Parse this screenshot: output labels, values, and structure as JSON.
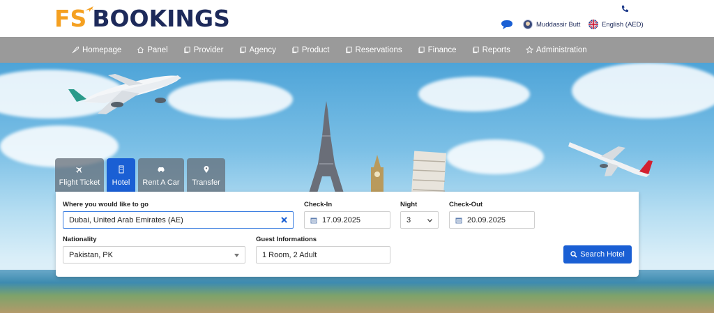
{
  "brand": {
    "prefix": "FS",
    "name": "BOOKINGS",
    "prefix_color": "#f5a020",
    "name_color": "#1d2a5a"
  },
  "header": {
    "user_name": "Muddassir Butt",
    "language": "English (AED)",
    "icons": [
      "phone-icon",
      "chat-icon",
      "avatar",
      "uk-flag-icon"
    ]
  },
  "nav": {
    "background": "#9a9a9a",
    "items": [
      {
        "label": "Homepage",
        "icon": "rocket-icon"
      },
      {
        "label": "Panel",
        "icon": "home-icon"
      },
      {
        "label": "Provider",
        "icon": "copy-icon"
      },
      {
        "label": "Agency",
        "icon": "copy-icon"
      },
      {
        "label": "Product",
        "icon": "copy-icon"
      },
      {
        "label": "Reservations",
        "icon": "copy-icon"
      },
      {
        "label": "Finance",
        "icon": "copy-icon"
      },
      {
        "label": "Reports",
        "icon": "copy-icon"
      },
      {
        "label": "Administration",
        "icon": "star-icon"
      }
    ]
  },
  "tabs": [
    {
      "label": "Flight Ticket",
      "icon": "plane-icon",
      "active": false
    },
    {
      "label": "Hotel",
      "icon": "building-icon",
      "active": true
    },
    {
      "label": "Rent A Car",
      "icon": "car-icon",
      "active": false
    },
    {
      "label": "Transfer",
      "icon": "pin-icon",
      "active": false
    }
  ],
  "search": {
    "destination_label": "Where you would like to go",
    "destination_value": "Dubai, United Arab Emirates (AE)",
    "checkin_label": "Check-In",
    "checkin_value": "17.09.2025",
    "night_label": "Night",
    "night_value": "3",
    "checkout_label": "Check-Out",
    "checkout_value": "20.09.2025",
    "nationality_label": "Nationality",
    "nationality_value": "Pakistan, PK",
    "guest_label": "Guest Informations",
    "guest_value": "1 Room, 2 Adult",
    "button_label": "Search Hotel",
    "accent": "#1a5fd4"
  }
}
